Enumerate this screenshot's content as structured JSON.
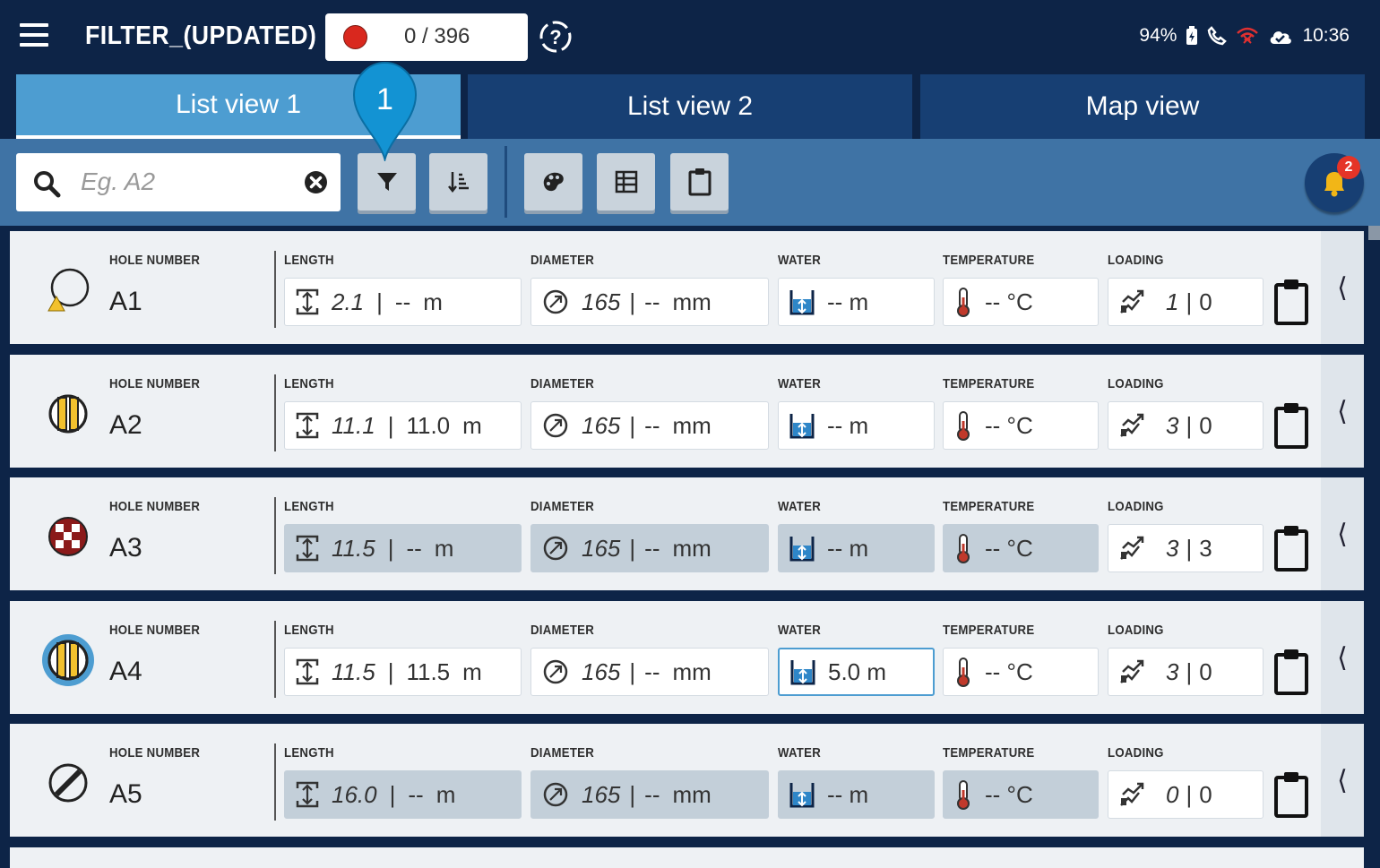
{
  "app": {
    "title": "FILTER_(UPDATED)"
  },
  "counter": {
    "text": "0 / 396"
  },
  "status": {
    "battery": "94%",
    "time": "10:36"
  },
  "tabs": [
    {
      "label": "List view 1",
      "active": true
    },
    {
      "label": "List view 2",
      "active": false
    },
    {
      "label": "Map view",
      "active": false
    }
  ],
  "search": {
    "placeholder": "Eg. A2",
    "value": ""
  },
  "notifications": {
    "count": "2"
  },
  "callout": {
    "number": "1"
  },
  "labels": {
    "hole": "HOLE NUMBER",
    "length": "LENGTH",
    "diameter": "DIAMETER",
    "water": "WATER",
    "temperature": "TEMPERATURE",
    "loading": "LOADING"
  },
  "rows": [
    {
      "id": "A1",
      "symbol": "circle-triangle-icon",
      "length_a": "2.1",
      "length_b": "--",
      "length_unit": "m",
      "diameter_a": "165",
      "diameter_b": "--",
      "diameter_unit": "mm",
      "water": "-- m",
      "temperature": "-- °C",
      "loading_a": "1",
      "loading_b": "0",
      "greyed": false,
      "water_active": false
    },
    {
      "id": "A2",
      "symbol": "striped-circle-icon",
      "length_a": "11.1",
      "length_b": "11.0",
      "length_unit": "m",
      "diameter_a": "165",
      "diameter_b": "--",
      "diameter_unit": "mm",
      "water": "-- m",
      "temperature": "-- °C",
      "loading_a": "3",
      "loading_b": "0",
      "greyed": false,
      "water_active": false
    },
    {
      "id": "A3",
      "symbol": "checkered-circle-icon",
      "length_a": "11.5",
      "length_b": "--",
      "length_unit": "m",
      "diameter_a": "165",
      "diameter_b": "--",
      "diameter_unit": "mm",
      "water": "-- m",
      "temperature": "-- °C",
      "loading_a": "3",
      "loading_b": "3",
      "greyed": true,
      "water_active": false
    },
    {
      "id": "A4",
      "symbol": "striped-circle-selected-icon",
      "length_a": "11.5",
      "length_b": "11.5",
      "length_unit": "m",
      "diameter_a": "165",
      "diameter_b": "--",
      "diameter_unit": "mm",
      "water": "5.0 m",
      "temperature": "-- °C",
      "loading_a": "3",
      "loading_b": "0",
      "greyed": false,
      "water_active": true
    },
    {
      "id": "A5",
      "symbol": "slashed-circle-icon",
      "length_a": "16.0",
      "length_b": "--",
      "length_unit": "m",
      "diameter_a": "165",
      "diameter_b": "--",
      "diameter_unit": "mm",
      "water": "-- m",
      "temperature": "-- °C",
      "loading_a": "0",
      "loading_b": "0",
      "greyed": true,
      "water_active": false
    }
  ],
  "colors": {
    "navy": "#0d2447",
    "tab_active": "#4d9dd1",
    "tab_inactive": "#173f73",
    "toolbar": "#3f73a5",
    "greyed_field": "#c3cfd9",
    "record": "#d9281e",
    "badge": "#e53427",
    "symbol_yellow": "#f2c12e"
  }
}
